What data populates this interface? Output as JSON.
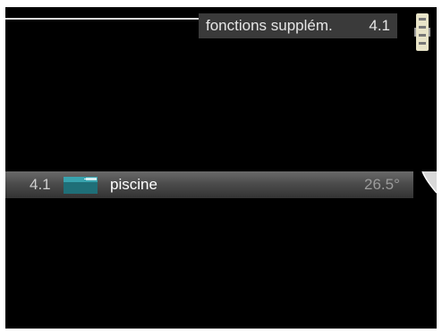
{
  "header": {
    "title": "fonctions supplém.",
    "menu_number": "4.1"
  },
  "menu": {
    "item": {
      "number": "4.1",
      "label": "piscine",
      "value": "26.5°",
      "icon": "pool-icon"
    }
  },
  "colors": {
    "screen_bg": "#000000",
    "title_bg": "#3a3a3a",
    "pool_accent": "#2e8f9a"
  }
}
